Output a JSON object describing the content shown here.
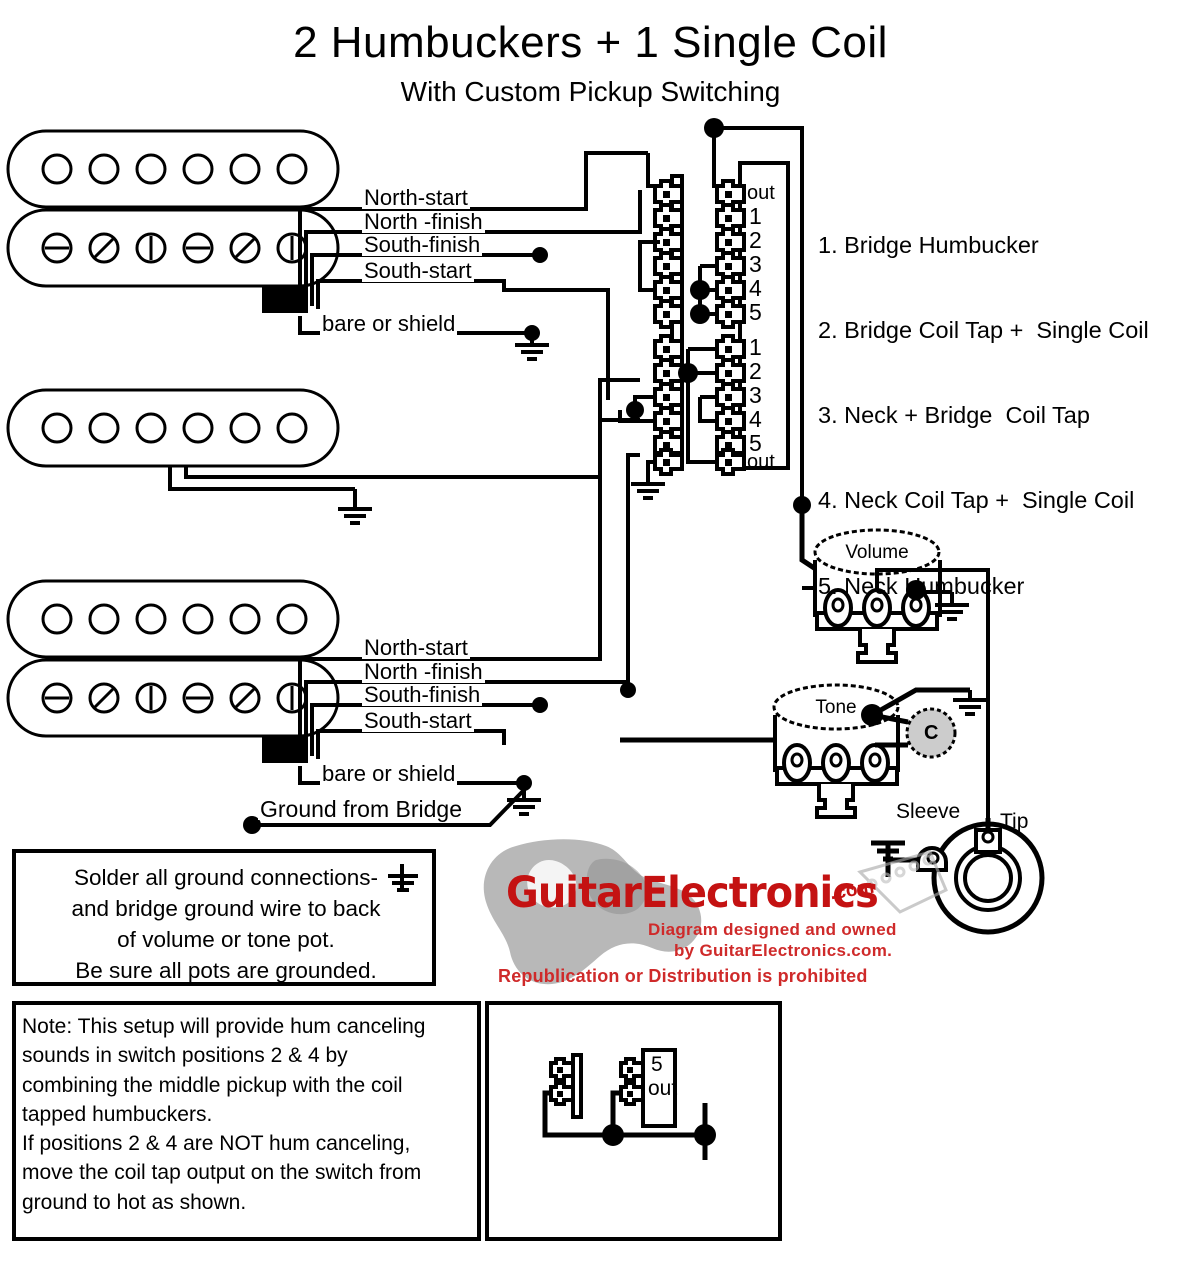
{
  "title": "2 Humbuckers + 1 Single Coil",
  "subtitle": "With Custom Pickup Switching",
  "legend": {
    "items": [
      "1. Bridge Humbucker",
      "2. Bridge Coil Tap +  Single Coil",
      "3. Neck + Bridge  Coil Tap",
      "4. Neck Coil Tap +  Single Coil",
      "5. Neck Humbucker"
    ]
  },
  "bridge_pickup": {
    "wires": {
      "north_start": "North-start",
      "north_finish": "North -finish",
      "south_finish": "South-finish",
      "south_start": "South-start",
      "bare": "bare or shield"
    }
  },
  "neck_pickup": {
    "wires": {
      "north_start": "North-start",
      "north_finish": "North -finish",
      "south_finish": "South-finish",
      "south_start": "South-start",
      "bare": "bare or shield"
    },
    "ground_from_bridge": "Ground from Bridge"
  },
  "switch": {
    "upper_labels": [
      "out",
      "1",
      "2",
      "3",
      "4",
      "5"
    ],
    "lower_labels": [
      "1",
      "2",
      "3",
      "4",
      "5",
      "out"
    ]
  },
  "controls": {
    "volume_label": "Volume",
    "tone_label": "Tone",
    "cap_label": "C"
  },
  "jack": {
    "sleeve_label": "Sleeve",
    "tip_label": "Tip"
  },
  "notes": {
    "solder": "Solder all ground connections-\nand bridge ground wire to back\nof volume or tone pot.\nBe sure all pots are grounded.",
    "hum": "Note: This setup will provide hum canceling\nsounds in switch positions 2 & 4 by\ncombining the middle pickup with the coil\ntapped humbuckers.\nIf positions 2 & 4 are NOT hum canceling,\nmove the coil tap output on the switch from\nground to hot as shown."
  },
  "inset": {
    "label_5": "5",
    "label_out": "out"
  },
  "logo": {
    "brand": "GuitarElectronics",
    "dotcom": ".com",
    "tagline1": "Diagram designed and owned",
    "tagline2": "by GuitarElectronics.com.",
    "tagline3": "Republication or Distribution is prohibited"
  },
  "colors": {
    "wire": "#000000",
    "background": "#ffffff",
    "logo_red": "#c41212",
    "cap_gray": "#cccccc"
  }
}
